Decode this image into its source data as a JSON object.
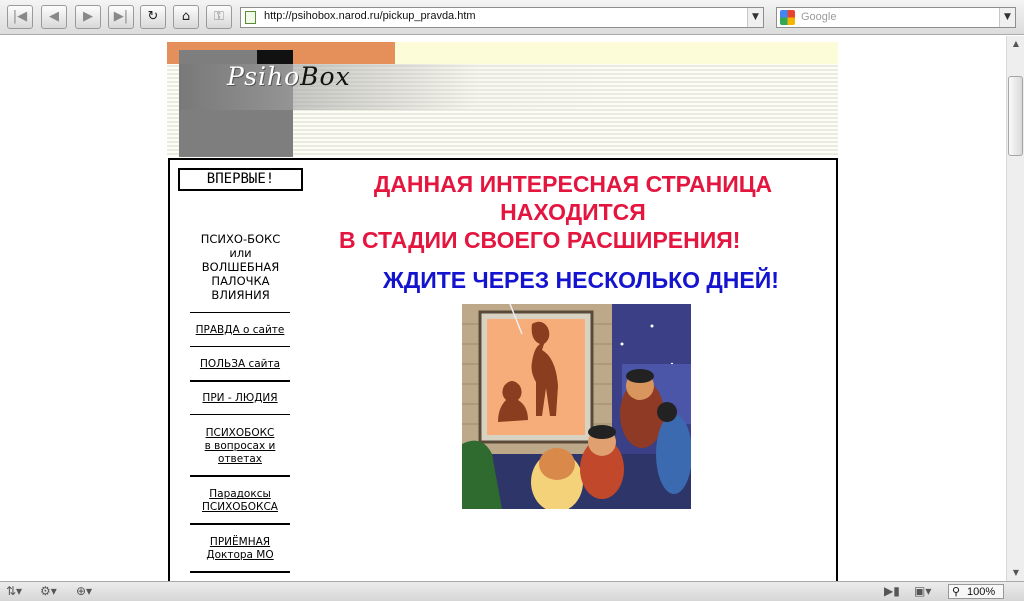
{
  "browser": {
    "url": "http://psihobox.narod.ru/pickup_pravda.htm",
    "search_placeholder": "Google",
    "zoom": "100%"
  },
  "header": {
    "logo_light": "Psiho",
    "logo_dark": "Box"
  },
  "sidebar": {
    "first_button": "ВПЕРВЫЕ!",
    "heading_lines": [
      "ПСИХО-БОКС",
      "или",
      "ВОЛШЕБНАЯ",
      "ПАЛОЧКА",
      "ВЛИЯНИЯ"
    ],
    "links": [
      {
        "lines": [
          "ПРАВДА о сайте"
        ]
      },
      {
        "lines": [
          "ПОЛЬЗА сайта"
        ]
      },
      {
        "lines": [
          "ПРИ - ЛЮДИЯ"
        ]
      },
      {
        "lines": [
          "ПСИХОБОКС",
          "в вопросах и",
          "ответах"
        ]
      },
      {
        "lines": [
          "Парадоксы",
          "ПСИХОБОКСА"
        ]
      },
      {
        "lines": [
          "ПРИЁМНАЯ",
          "Доктора МО"
        ]
      }
    ]
  },
  "content": {
    "headline_red": [
      "ДАННАЯ ИНТЕРЕСНАЯ СТРАНИЦА",
      "НАХОДИТСЯ",
      "В СТАДИИ СВОЕГО РАСШИРЕНИЯ!"
    ],
    "headline_blue": "ЖДИТЕ ЧЕРЕЗ НЕСКОЛЬКО ДНЕЙ!"
  },
  "colors": {
    "red_text": "#e4163f",
    "blue_text": "#1414d0",
    "banner_orange": "#e5905b"
  }
}
